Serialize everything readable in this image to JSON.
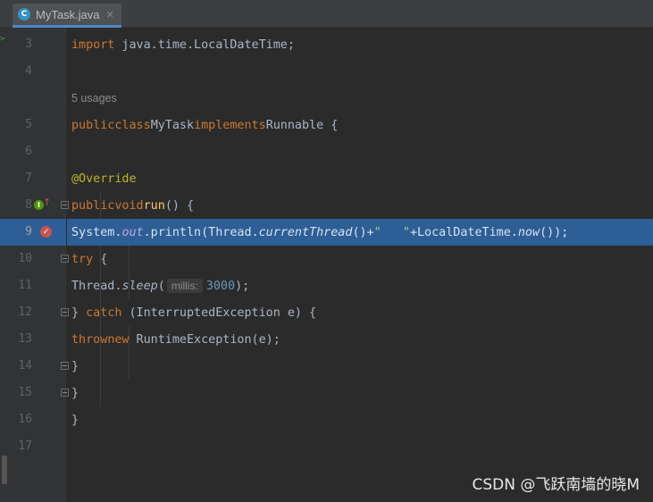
{
  "tab": {
    "icon": "java-class-icon",
    "icon_letter": "C",
    "label": "MyTask.java",
    "close": "✕"
  },
  "gutter": {
    "line_numbers": [
      "3",
      "4",
      "5",
      "6",
      "7",
      "8",
      "9",
      "10",
      "11",
      "12",
      "13",
      "14",
      "15",
      "16",
      "17"
    ],
    "current_line": "9"
  },
  "code": {
    "usages": "5 usages",
    "l3": {
      "kw": "import",
      "rest": " java.time.LocalDateTime;"
    },
    "l5": {
      "kw1": "public",
      "kw2": "class",
      "name": "MyTask",
      "kw3": "implements",
      "iface": "Runnable",
      "brace": " {"
    },
    "l7": {
      "annotation": "@Override"
    },
    "l8": {
      "kw1": "public",
      "kw2": "void",
      "method": "run",
      "rest": "() {"
    },
    "l9": {
      "cls": "System.",
      "field": "out",
      "p1": ".println(Thread.",
      "static": "currentThread",
      "p2": "()+",
      "str": "\"   \"",
      "p3": "+LocalDateTime.",
      "static2": "now",
      "p4": "());"
    },
    "l10": {
      "kw": "try",
      "rest": " {"
    },
    "l11": {
      "p1": "Thread.",
      "static": "sleep",
      "p2": "(",
      "hint": "millis:",
      "num": "3000",
      "p3": ");"
    },
    "l12": {
      "p1": "} ",
      "kw": "catch",
      "rest": " (InterruptedException e) {"
    },
    "l13": {
      "kw1": "throw",
      "kw2": "new",
      "rest": " RuntimeException(e);"
    },
    "l14": {
      "text": "}"
    },
    "l15": {
      "text": "}"
    },
    "l16": {
      "text": "}"
    }
  },
  "watermark": "CSDN @飞跃南墙的晓M",
  "colors": {
    "keyword": "#cc7832",
    "annotation": "#bbb529",
    "highlight": "#2d5e95",
    "number": "#6897bb",
    "string": "#6a8759"
  }
}
